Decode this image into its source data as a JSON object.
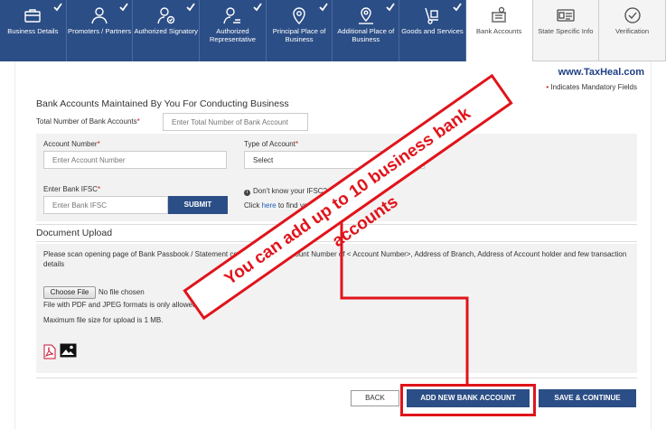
{
  "tabs": [
    {
      "label": "Business Details",
      "icon": "briefcase-icon",
      "state": "done"
    },
    {
      "label": "Promoters / Partners",
      "icon": "person-icon",
      "state": "done"
    },
    {
      "label": "Authorized Signatory",
      "icon": "signatory-icon",
      "state": "done"
    },
    {
      "label": "Authorized Representative",
      "icon": "representative-icon",
      "state": "done"
    },
    {
      "label": "Principal Place of Business",
      "icon": "location-pin-icon",
      "state": "done"
    },
    {
      "label": "Additional Place of Business",
      "icon": "multi-location-icon",
      "state": "done"
    },
    {
      "label": "Goods and Services",
      "icon": "hand-truck-icon",
      "state": "done"
    },
    {
      "label": "Bank Accounts",
      "icon": "bank-icon",
      "state": "active"
    },
    {
      "label": "State Specific Info",
      "icon": "id-card-icon",
      "state": "pending"
    },
    {
      "label": "Verification",
      "icon": "verify-check-icon",
      "state": "pending"
    }
  ],
  "watermark": "www.TaxHeal.com",
  "mandatory_note": "Indicates Mandatory Fields",
  "section_title": "Bank Accounts Maintained By You For Conducting Business",
  "total_accounts": {
    "label": "Total Number of Bank Accounts",
    "placeholder": "Enter Total Number of Bank Account"
  },
  "account_number": {
    "label": "Account Number",
    "placeholder": "Enter Account Number"
  },
  "account_type": {
    "label": "Type of Account",
    "value": "Select"
  },
  "ifsc": {
    "label": "Enter Bank IFSC",
    "placeholder": "Enter Bank IFSC",
    "submit_label": "SUBMIT"
  },
  "ifsc_help": {
    "question": "Don't know your IFSC?",
    "prefix": "Click",
    "link": "here",
    "suffix": "to find your bank"
  },
  "document_upload": {
    "title": "Document Upload",
    "instructions": "Please scan opening page of Bank Passbook / Statement containing Bank Account Number of < Account Number>, Address of Branch, Address of Account holder and few transaction details",
    "choose_file_label": "Choose File",
    "no_file_text": "No file chosen",
    "formats_note": "File with PDF and JPEG formats is only allowed.",
    "max_size_note": "Maximum file size for upload is 1 MB."
  },
  "buttons": {
    "back": "BACK",
    "add_new": "ADD NEW BANK ACCOUNT",
    "save_continue": "SAVE & CONTINUE"
  },
  "annotation": {
    "text": "You can add up to 10 business bank accounts",
    "color": "#e0141b"
  },
  "colors": {
    "nav": "#2c4e86",
    "accent_red": "#e0141b",
    "link": "#1e5eb8"
  }
}
